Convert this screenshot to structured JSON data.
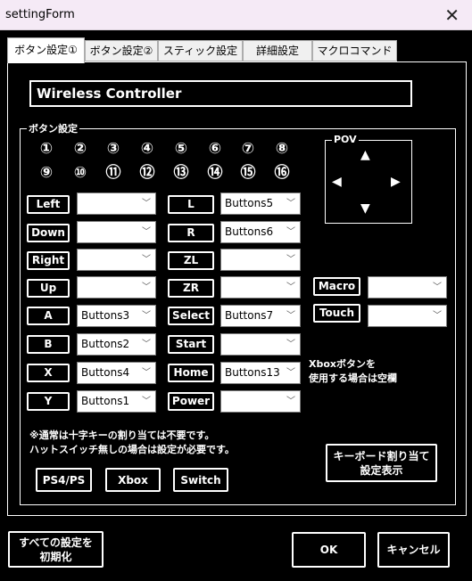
{
  "window": {
    "title": "settingForm",
    "close_glyph": "✕"
  },
  "tabs": [
    "ボタン設定①",
    "ボタン設定②",
    "スティック設定",
    "詳細設定",
    "マクロコマンド"
  ],
  "controller_name": "Wireless Controller",
  "button_group_label": "ボタン設定",
  "numbers_row1": [
    "①",
    "②",
    "③",
    "④",
    "⑤",
    "⑥",
    "⑦",
    "⑧"
  ],
  "numbers_row2": [
    "⑨",
    "⑩",
    "⑪",
    "⑫",
    "⑬",
    "⑭",
    "⑮",
    "⑯"
  ],
  "pov": {
    "label": "POV",
    "up": "▲",
    "down": "▼",
    "left": "◀",
    "right": "▶"
  },
  "left_column": [
    {
      "label": "Left",
      "value": ""
    },
    {
      "label": "Down",
      "value": ""
    },
    {
      "label": "Right",
      "value": ""
    },
    {
      "label": "Up",
      "value": ""
    },
    {
      "label": "A",
      "value": "Buttons3"
    },
    {
      "label": "B",
      "value": "Buttons2"
    },
    {
      "label": "X",
      "value": "Buttons4"
    },
    {
      "label": "Y",
      "value": "Buttons1"
    }
  ],
  "middle_column": [
    {
      "label": "L",
      "value": "Buttons5"
    },
    {
      "label": "R",
      "value": "Buttons6"
    },
    {
      "label": "ZL",
      "value": ""
    },
    {
      "label": "ZR",
      "value": ""
    },
    {
      "label": "Select",
      "value": "Buttons7"
    },
    {
      "label": "Start",
      "value": ""
    },
    {
      "label": "Home",
      "value": "Buttons13"
    },
    {
      "label": "Power",
      "value": ""
    }
  ],
  "right_column": [
    {
      "label": "Macro",
      "value": ""
    },
    {
      "label": "Touch",
      "value": ""
    }
  ],
  "chevron": "﹀",
  "xbox_note": [
    "Xboxボタンを",
    "使用する場合は空欄"
  ],
  "bottom_note": [
    "※通常は十字キーの割り当ては不要です。",
    "ハットスイッチ無しの場合は設定が必要です。"
  ],
  "preset_buttons": [
    "PS4/PS",
    "Xbox",
    "Switch"
  ],
  "keyboard_button": [
    "キーボード割り当て",
    "設定表示"
  ],
  "reset_button": [
    "すべての設定を",
    "初期化"
  ],
  "ok_button": "OK",
  "cancel_button": "キャンセル"
}
